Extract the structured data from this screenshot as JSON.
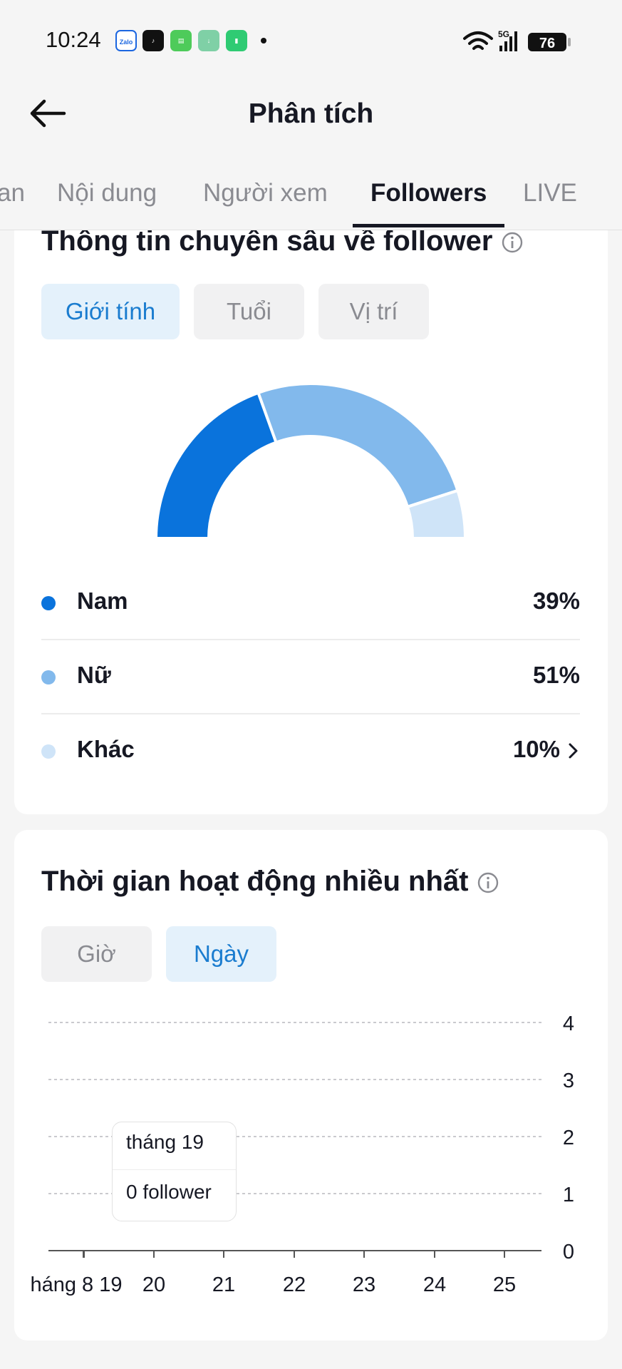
{
  "status_bar": {
    "time": "10:24",
    "battery": "76",
    "network": "5G",
    "notification_icons": [
      "zalo-icon",
      "tiktok-icon",
      "messages-icon",
      "download-icon",
      "battery-saver-icon"
    ]
  },
  "header": {
    "title": "Phân tích"
  },
  "tabs": [
    {
      "label": "an",
      "active": false
    },
    {
      "label": "Nội dung",
      "active": false
    },
    {
      "label": "Người xem",
      "active": false
    },
    {
      "label": "Followers",
      "active": true
    },
    {
      "label": "LIVE",
      "active": false
    }
  ],
  "insights": {
    "title": "Thông tin chuyên sâu về follower",
    "segments": [
      {
        "label": "Giới tính",
        "active": true
      },
      {
        "label": "Tuổi",
        "active": false
      },
      {
        "label": "Vị trí",
        "active": false
      }
    ],
    "gender": [
      {
        "name": "Nam",
        "value": "39%",
        "fraction": 0.39,
        "color": "#0a73dc"
      },
      {
        "name": "Nữ",
        "value": "51%",
        "fraction": 0.51,
        "color": "#82b9ec"
      },
      {
        "name": "Khác",
        "value": "10%",
        "fraction": 0.1,
        "color": "#cfe4f8"
      }
    ]
  },
  "active_times": {
    "title": "Thời gian hoạt động nhiều nhất",
    "segments": [
      {
        "label": "Giờ",
        "active": false
      },
      {
        "label": "Ngày",
        "active": true
      }
    ],
    "tooltip": {
      "date": "tháng 19",
      "value": "0 follower"
    }
  },
  "chart_data": {
    "type": "bar",
    "categories": [
      "19",
      "20",
      "21",
      "22",
      "23",
      "24",
      "25"
    ],
    "first_tick_label": "háng 8 19",
    "values": [
      0,
      0,
      0,
      0,
      0,
      0,
      0
    ],
    "y_ticks": [
      "4",
      "3",
      "2",
      "1",
      "0"
    ],
    "ylim": [
      0,
      4
    ],
    "grid": true,
    "axis_position": "right",
    "color": "#0a73dc"
  },
  "colors": {
    "accent": "#1a7ccf",
    "text": "#161823",
    "muted": "#8a8b91"
  }
}
